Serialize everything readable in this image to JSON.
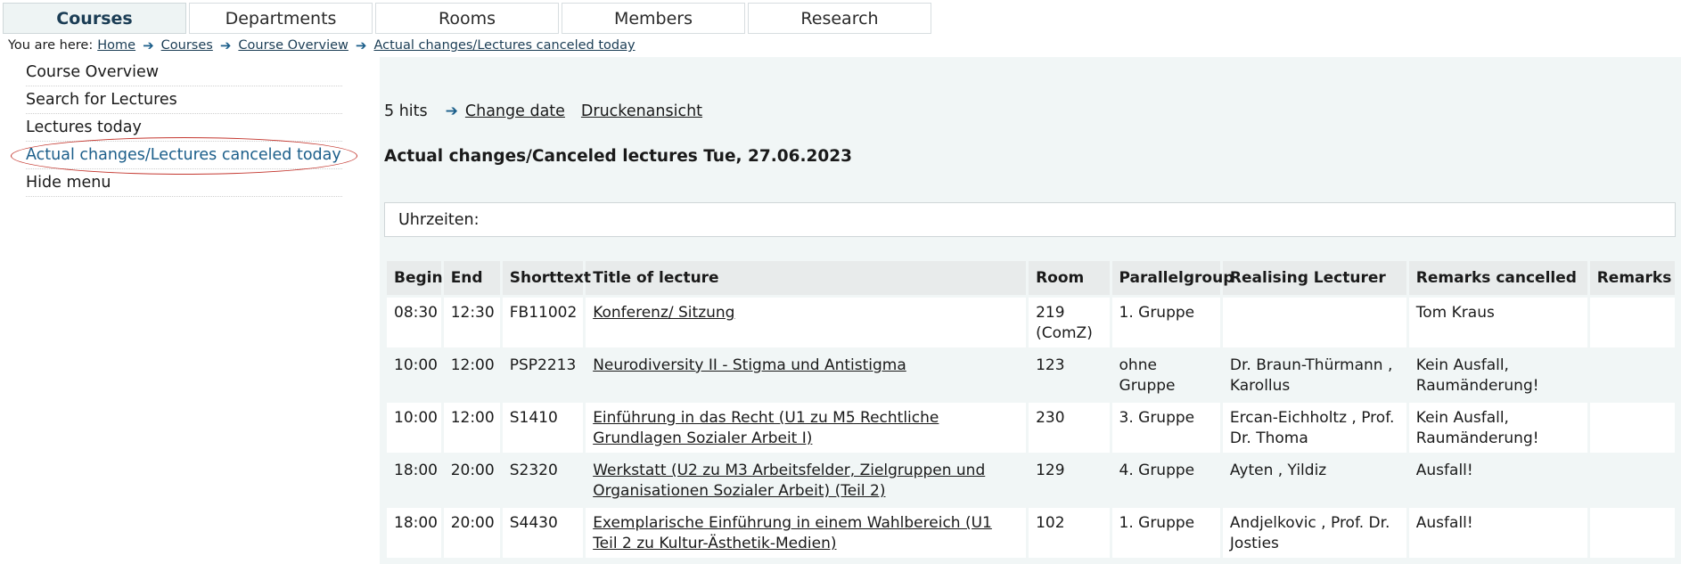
{
  "topnav": {
    "tabs": [
      {
        "label": "Courses",
        "active": true
      },
      {
        "label": "Departments",
        "active": false
      },
      {
        "label": "Rooms",
        "active": false
      },
      {
        "label": "Members",
        "active": false
      },
      {
        "label": "Research",
        "active": false
      }
    ]
  },
  "breadcrumb": {
    "prefix": "You are here:",
    "items": [
      "Home",
      "Courses",
      "Course Overview",
      "Actual changes/Lectures canceled today"
    ]
  },
  "sidebar": {
    "items": [
      {
        "label": "Course Overview"
      },
      {
        "label": "Search for Lectures"
      },
      {
        "label": "Lectures today"
      },
      {
        "label": "Actual changes/Lectures canceled today",
        "current": true
      },
      {
        "label": "Hide menu"
      }
    ]
  },
  "toolbar": {
    "hits": "5 hits",
    "change_date": "Change date",
    "print_view": "Druckenansicht"
  },
  "heading": "Actual changes/Canceled lectures Tue, 27.06.2023",
  "times_label": "Uhrzeiten:",
  "table": {
    "headers": [
      "Begin",
      "End",
      "Shorttext",
      "Title of lecture",
      "Room",
      "Parallelgroup",
      "Realising Lecturer",
      "Remarks cancelled",
      "Remarks"
    ],
    "rows": [
      {
        "begin": "08:30",
        "end": "12:30",
        "short": "FB11002",
        "title": "Konferenz/ Sitzung",
        "room": "219 (ComZ)",
        "group": "1. Gruppe",
        "lecturer": "",
        "remarks_cancelled": "Tom Kraus",
        "remarks": ""
      },
      {
        "begin": "10:00",
        "end": "12:00",
        "short": "PSP2213",
        "title": "Neurodiversity II - Stigma und Antistigma",
        "room": "123",
        "group": "ohne Gruppe",
        "lecturer": "Dr. Braun-Thürmann , Karollus",
        "remarks_cancelled": "Kein Ausfall, Raumänderung!",
        "remarks": ""
      },
      {
        "begin": "10:00",
        "end": "12:00",
        "short": "S1410",
        "title": "Einführung in das Recht (U1 zu M5 Rechtliche Grundlagen Sozialer Arbeit I)",
        "room": "230",
        "group": "3. Gruppe",
        "lecturer": "Ercan-Eichholtz , Prof. Dr. Thoma",
        "remarks_cancelled": "Kein Ausfall, Raumänderung!",
        "remarks": ""
      },
      {
        "begin": "18:00",
        "end": "20:00",
        "short": "S2320",
        "title": "Werkstatt (U2 zu M3 Arbeitsfelder, Zielgruppen und Organisationen Sozialer Arbeit) (Teil 2)",
        "room": "129",
        "group": "4. Gruppe",
        "lecturer": "Ayten , Yildiz",
        "remarks_cancelled": "Ausfall!",
        "remarks": ""
      },
      {
        "begin": "18:00",
        "end": "20:00",
        "short": "S4430",
        "title": "Exemplarische Einführung in einem Wahlbereich (U1 Teil 2 zu Kultur-Ästhetik-Medien)",
        "room": "102",
        "group": "1. Gruppe",
        "lecturer": "Andjelkovic , Prof. Dr. Josties",
        "remarks_cancelled": "Ausfall!",
        "remarks": ""
      }
    ]
  },
  "colors": {
    "accent": "#1b5e8a",
    "annotation": "#c4372f",
    "panel": "#f1f6f6"
  },
  "icons": {
    "breadcrumb_separator": "arrow-right-icon",
    "toolbar": "arrow-right-icon"
  }
}
